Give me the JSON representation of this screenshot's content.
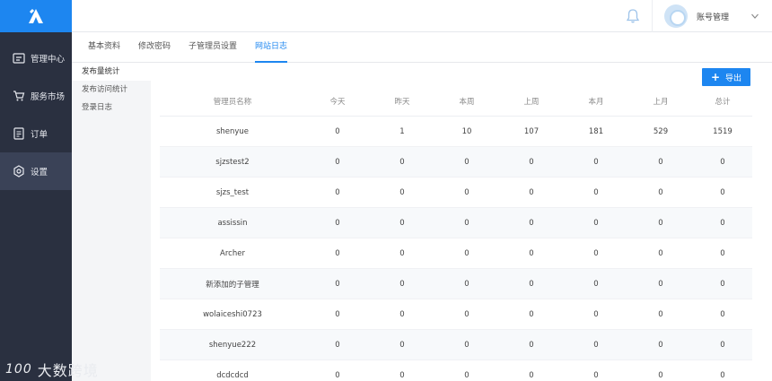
{
  "sidebar": {
    "items": [
      {
        "label": "管理中心",
        "icon": "edit-box-icon"
      },
      {
        "label": "服务市场",
        "icon": "shopping-cart-icon"
      },
      {
        "label": "订单",
        "icon": "document-icon"
      },
      {
        "label": "设置",
        "icon": "gear-icon"
      }
    ],
    "active_index": 3
  },
  "header": {
    "account_name": "账号管理"
  },
  "tabs": [
    {
      "label": "基本资料"
    },
    {
      "label": "修改密码"
    },
    {
      "label": "子管理员设置"
    },
    {
      "label": "网站日志"
    }
  ],
  "active_tab": 3,
  "subnav": [
    {
      "label": "发布量统计"
    },
    {
      "label": "发布访问统计"
    },
    {
      "label": "登录日志"
    }
  ],
  "export_label": "导出",
  "table": {
    "columns": [
      "管理员名称",
      "今天",
      "昨天",
      "本周",
      "上周",
      "本月",
      "上月",
      "总计"
    ],
    "rows": [
      [
        "shenyue",
        "0",
        "1",
        "10",
        "107",
        "181",
        "529",
        "1519"
      ],
      [
        "sjzstest2",
        "0",
        "0",
        "0",
        "0",
        "0",
        "0",
        "0"
      ],
      [
        "sjzs_test",
        "0",
        "0",
        "0",
        "0",
        "0",
        "0",
        "0"
      ],
      [
        "assissin",
        "0",
        "0",
        "0",
        "0",
        "0",
        "0",
        "0"
      ],
      [
        "Archer",
        "0",
        "0",
        "0",
        "0",
        "0",
        "0",
        "0"
      ],
      [
        "新添加的子管理",
        "0",
        "0",
        "0",
        "0",
        "0",
        "0",
        "0"
      ],
      [
        "wolaiceshi0723",
        "0",
        "0",
        "0",
        "0",
        "0",
        "0",
        "0"
      ],
      [
        "shenyue222",
        "0",
        "0",
        "0",
        "0",
        "0",
        "0",
        "0"
      ],
      [
        "dcdcdcd",
        "0",
        "0",
        "0",
        "0",
        "0",
        "0",
        "0"
      ]
    ]
  },
  "watermark": {
    "logo": "100",
    "text": "大数跨境"
  },
  "colors": {
    "accent": "#1d86f0",
    "sidebar_bg": "#2a3040",
    "sidebar_active": "#3a4257"
  }
}
